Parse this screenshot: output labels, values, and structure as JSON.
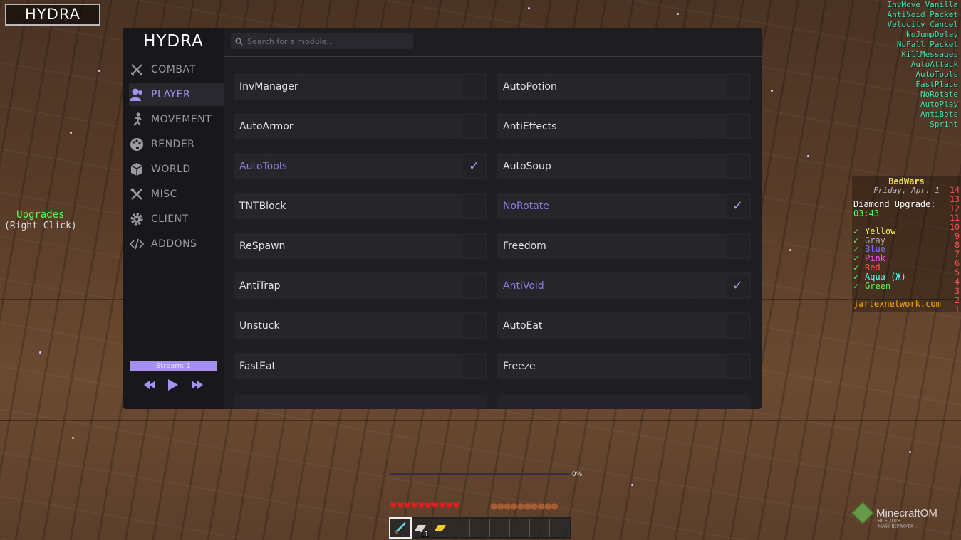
{
  "app": {
    "logo_label": "HYDRA",
    "brand": "HYDRA"
  },
  "search": {
    "placeholder": "Search for a module..."
  },
  "categories": [
    {
      "label": "COMBAT",
      "icon": "swords-icon",
      "active": false
    },
    {
      "label": "PLAYER",
      "icon": "user-icon",
      "active": true
    },
    {
      "label": "MOVEMENT",
      "icon": "running-icon",
      "active": false
    },
    {
      "label": "RENDER",
      "icon": "palette-icon",
      "active": false
    },
    {
      "label": "WORLD",
      "icon": "cube-icon",
      "active": false
    },
    {
      "label": "MISC",
      "icon": "tools-icon",
      "active": false
    },
    {
      "label": "CLIENT",
      "icon": "gear-icon",
      "active": false
    },
    {
      "label": "ADDONS",
      "icon": "code-icon",
      "active": false
    }
  ],
  "stream": {
    "label": "Stream: 1"
  },
  "modules_left": [
    {
      "name": "InvManager",
      "enabled": false
    },
    {
      "name": "AutoArmor",
      "enabled": false
    },
    {
      "name": "AutoTools",
      "enabled": true
    },
    {
      "name": "TNTBlock",
      "enabled": false
    },
    {
      "name": "ReSpawn",
      "enabled": false
    },
    {
      "name": "AntiTrap",
      "enabled": false
    },
    {
      "name": "Unstuck",
      "enabled": false
    },
    {
      "name": "FastEat",
      "enabled": false
    }
  ],
  "modules_right": [
    {
      "name": "AutoPotion",
      "enabled": false
    },
    {
      "name": "AntiEffects",
      "enabled": false
    },
    {
      "name": "AutoSoup",
      "enabled": false
    },
    {
      "name": "NoRotate",
      "enabled": true
    },
    {
      "name": "Freedom",
      "enabled": false
    },
    {
      "name": "AntiVoid",
      "enabled": true
    },
    {
      "name": "AutoEat",
      "enabled": false
    },
    {
      "name": "Freeze",
      "enabled": false
    }
  ],
  "arraylist": [
    "InvMove Vanilla",
    "AntiVoid Packet",
    "Velocity Cancel",
    "NoJumpDelay",
    "NoFall Packet",
    "KillMessages",
    "AutoAttack",
    "AutoTools",
    "FastPlace",
    "NoRotate",
    "AutoPlay",
    "AntiBots",
    "Sprint"
  ],
  "upgrades": {
    "title": "Upgrades",
    "subtitle": "(Right Click)"
  },
  "scoreboard": {
    "title": "BedWars",
    "date": "Friday, Apr. 1",
    "diamond_label": "Diamond Upgrade:",
    "diamond_time": "03:43",
    "teams": [
      {
        "name": "Yellow",
        "color": "#ffff55"
      },
      {
        "name": "Gray",
        "color": "#aaaaaa"
      },
      {
        "name": "Blue",
        "color": "#5555ff"
      },
      {
        "name": "Pink",
        "color": "#ff55ff"
      },
      {
        "name": "Red",
        "color": "#ff5555"
      },
      {
        "name": "Aqua (Ж)",
        "color": "#55ffff"
      },
      {
        "name": "Green",
        "color": "#55ff55"
      }
    ],
    "server": "jartexnetwork.com",
    "numbers": [
      "14",
      "13",
      "12",
      "11",
      "10",
      "9",
      "8",
      "7",
      "6",
      "5",
      "4",
      "3",
      "2",
      "1"
    ]
  },
  "hud": {
    "xp_percent": "0%",
    "xp_progress": 0,
    "hotbar_count": "11"
  },
  "watermark": {
    "brand": "MinecraftOM",
    "sub": "ВСЁ ДЛЯ МАЙНКРАФТА"
  },
  "colors": {
    "accent": "#a592f0",
    "enabled_text": "#8b7fdc",
    "arraylist": "#4ee0a0"
  }
}
